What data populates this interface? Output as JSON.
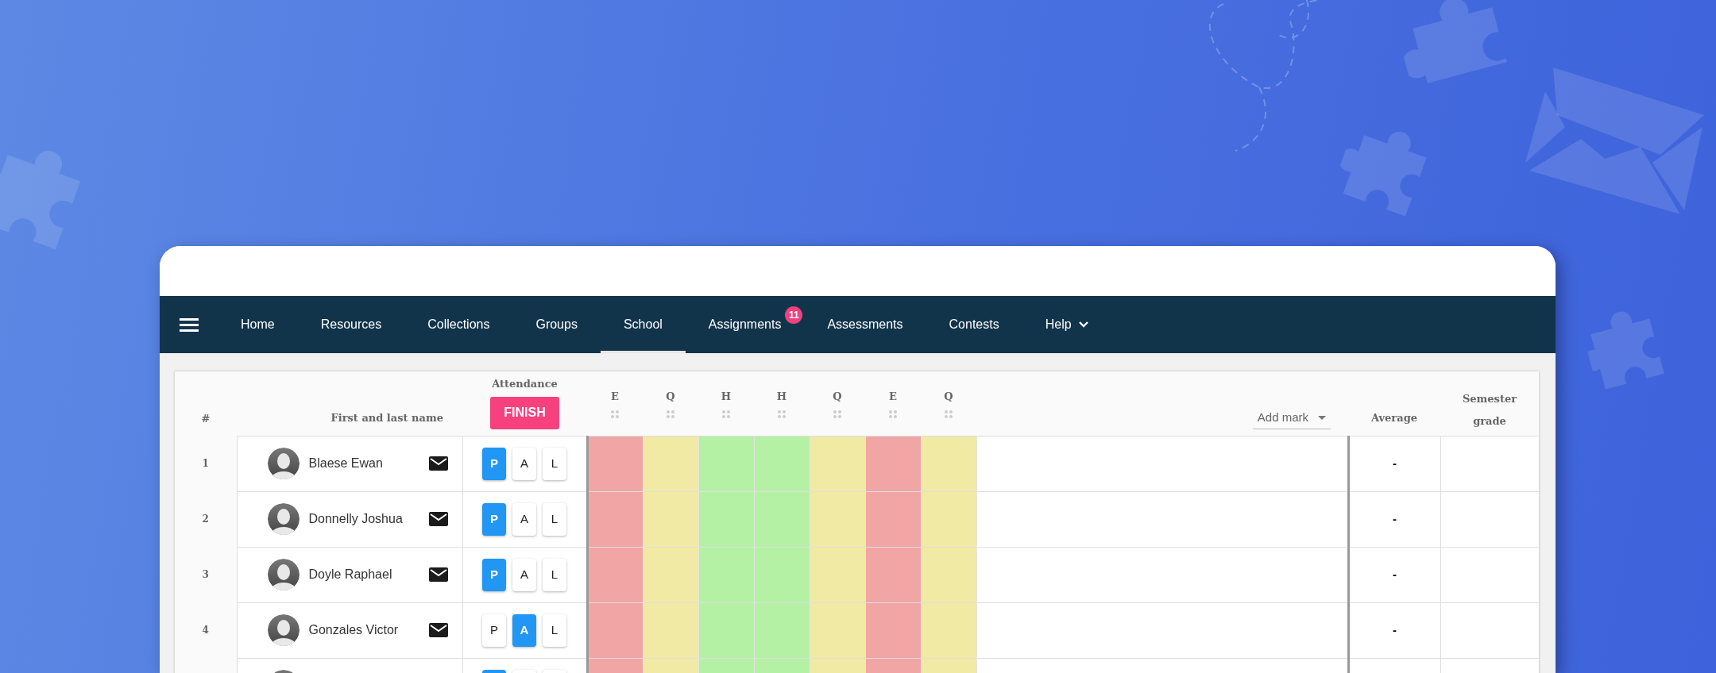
{
  "nav": {
    "items": [
      {
        "label": "Home",
        "selected": false,
        "dropdown": false
      },
      {
        "label": "Resources",
        "selected": false,
        "dropdown": false
      },
      {
        "label": "Collections",
        "selected": false,
        "dropdown": false
      },
      {
        "label": "Groups",
        "selected": false,
        "dropdown": false
      },
      {
        "label": "School",
        "selected": true,
        "dropdown": false
      },
      {
        "label": "Assignments",
        "selected": false,
        "dropdown": false,
        "badge": "11"
      },
      {
        "label": "Assessments",
        "selected": false,
        "dropdown": false
      },
      {
        "label": "Contests",
        "selected": false,
        "dropdown": false
      },
      {
        "label": "Help",
        "selected": false,
        "dropdown": true
      }
    ]
  },
  "columns": {
    "number": "#",
    "name": "First and last name",
    "attendance": "Attendance",
    "finish_button": "FINISH",
    "marks": [
      {
        "label": "E",
        "color": "#f1a5a5"
      },
      {
        "label": "Q",
        "color": "#f1eaa5"
      },
      {
        "label": "H",
        "color": "#b5f1a5"
      },
      {
        "label": "H",
        "color": "#b5f1a5"
      },
      {
        "label": "Q",
        "color": "#f1eaa5"
      },
      {
        "label": "E",
        "color": "#f1a5a5"
      },
      {
        "label": "Q",
        "color": "#f1eaa5"
      }
    ],
    "add_mark": "Add mark",
    "average": "Average",
    "semester_grade": "Semester grade"
  },
  "rows": [
    {
      "number": "1",
      "name": "Blaese Ewan",
      "attendance": [
        {
          "label": "P",
          "selected": true
        },
        {
          "label": "A",
          "selected": false
        },
        {
          "label": "L",
          "selected": false
        }
      ],
      "average": "-"
    },
    {
      "number": "2",
      "name": "Donnelly Joshua",
      "attendance": [
        {
          "label": "P",
          "selected": true
        },
        {
          "label": "A",
          "selected": false
        },
        {
          "label": "L",
          "selected": false
        }
      ],
      "average": "-"
    },
    {
      "number": "3",
      "name": "Doyle Raphael",
      "attendance": [
        {
          "label": "P",
          "selected": true
        },
        {
          "label": "A",
          "selected": false
        },
        {
          "label": "L",
          "selected": false
        }
      ],
      "average": "-"
    },
    {
      "number": "4",
      "name": "Gonzales Victor",
      "attendance": [
        {
          "label": "P",
          "selected": false
        },
        {
          "label": "A",
          "selected": true
        },
        {
          "label": "L",
          "selected": false
        }
      ],
      "average": "-"
    },
    {
      "attendance": [
        {
          "selected": true
        },
        {
          "selected": false
        },
        {
          "selected": false
        }
      ]
    }
  ]
}
